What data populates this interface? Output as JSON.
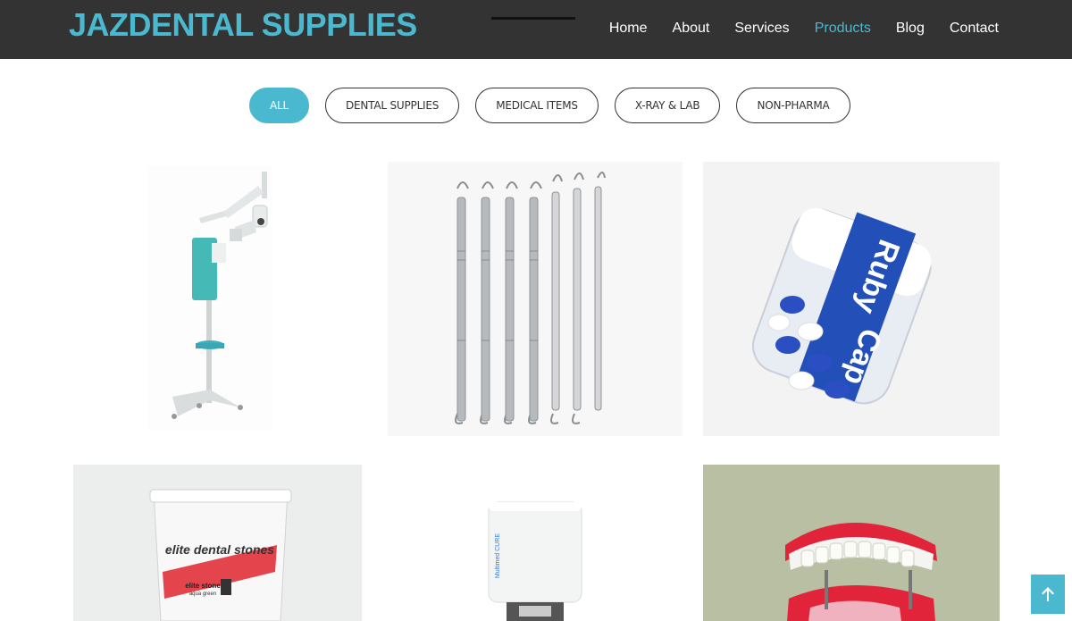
{
  "header": {
    "logo": "JAZDENTAL SUPPLIES",
    "nav": [
      {
        "label": "Home",
        "active": false
      },
      {
        "label": "About",
        "active": false
      },
      {
        "label": "Services",
        "active": false
      },
      {
        "label": "Products",
        "active": true
      },
      {
        "label": "Blog",
        "active": false
      },
      {
        "label": "Contact",
        "active": false
      }
    ]
  },
  "filters": [
    {
      "label": "ALL",
      "active": true
    },
    {
      "label": "DENTAL SUPPLIES",
      "active": false
    },
    {
      "label": "MEDICAL ITEMS",
      "active": false
    },
    {
      "label": "X-RAY & LAB",
      "active": false
    },
    {
      "label": "NON-PHARMA",
      "active": false
    }
  ],
  "products": {
    "jar_label_1": "Ruby",
    "jar_label_2": "Cap",
    "bucket_label": "elite dental stones",
    "bucket_sub_1": "elite stone",
    "bucket_sub_2": "aqua green",
    "device_label": "Multimed CURE"
  },
  "back_to_top": {
    "icon": "arrow-up-icon"
  },
  "colors": {
    "accent": "#4ab9cf",
    "header_bg": "#333333"
  }
}
